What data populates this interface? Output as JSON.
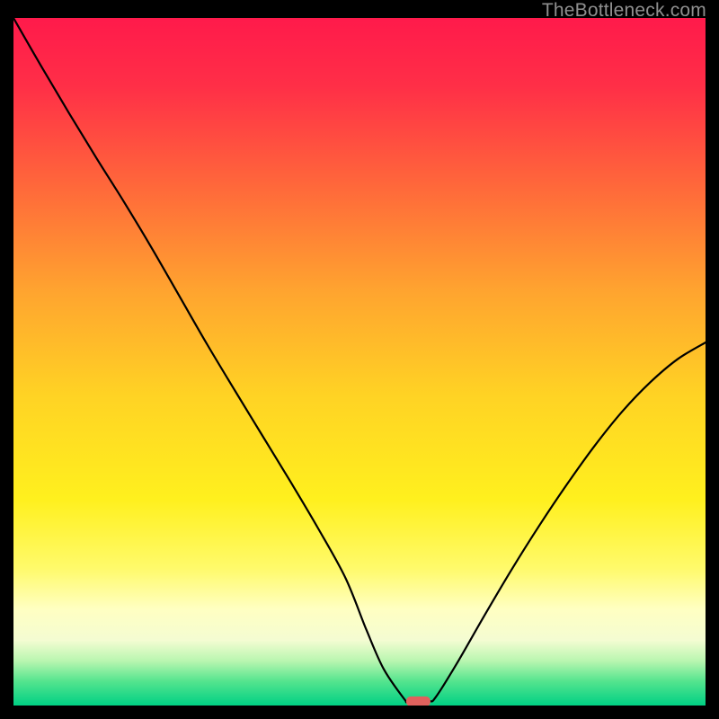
{
  "watermark": "TheBottleneck.com",
  "chart_data": {
    "type": "line",
    "title": "",
    "xlabel": "",
    "ylabel": "",
    "xlim": [
      0,
      100
    ],
    "ylim": [
      0,
      100
    ],
    "gradient_stops": [
      {
        "offset": 0.0,
        "color": "#ff1a4b"
      },
      {
        "offset": 0.1,
        "color": "#ff2f47"
      },
      {
        "offset": 0.25,
        "color": "#ff6a3a"
      },
      {
        "offset": 0.4,
        "color": "#ffa52f"
      },
      {
        "offset": 0.55,
        "color": "#ffd324"
      },
      {
        "offset": 0.7,
        "color": "#fff01e"
      },
      {
        "offset": 0.8,
        "color": "#fffa6a"
      },
      {
        "offset": 0.86,
        "color": "#ffffc2"
      },
      {
        "offset": 0.905,
        "color": "#f4fcd2"
      },
      {
        "offset": 0.935,
        "color": "#b9f6b0"
      },
      {
        "offset": 0.965,
        "color": "#54e48e"
      },
      {
        "offset": 1.0,
        "color": "#00d084"
      }
    ],
    "series": [
      {
        "name": "bottleneck-curve",
        "x": [
          0.0,
          4,
          8,
          12,
          16,
          20,
          24,
          28,
          32,
          36,
          40,
          44,
          48,
          51,
          53.5,
          56.5,
          57.0,
          60.0,
          61.0,
          64,
          68,
          72,
          76,
          80,
          84,
          88,
          92,
          96,
          100
        ],
        "y": [
          100,
          93,
          86.2,
          79.6,
          73.2,
          66.5,
          59.5,
          52.5,
          45.8,
          39.2,
          32.6,
          25.8,
          18.5,
          11.0,
          5.3,
          0.9,
          0.6,
          0.6,
          1.2,
          6.0,
          13.0,
          19.8,
          26.2,
          32.2,
          37.8,
          42.8,
          47.0,
          50.4,
          52.8
        ]
      }
    ],
    "marker": {
      "x": 58.5,
      "y": 0.6,
      "color": "#e0615d"
    }
  }
}
